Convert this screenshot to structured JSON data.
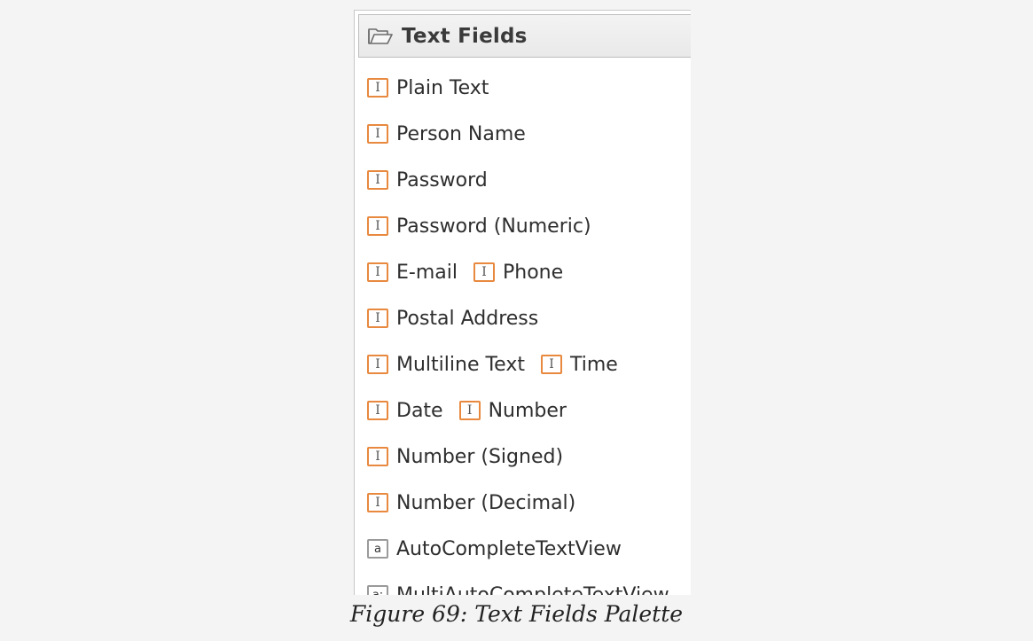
{
  "palette": {
    "header": {
      "title": "Text Fields",
      "icon": "folder-open-icon"
    },
    "rows": [
      [
        {
          "label": "Plain Text",
          "icon": "text-cursor-icon",
          "glyph": "I"
        }
      ],
      [
        {
          "label": "Person Name",
          "icon": "text-cursor-icon",
          "glyph": "I"
        }
      ],
      [
        {
          "label": "Password",
          "icon": "text-cursor-icon",
          "glyph": "I"
        }
      ],
      [
        {
          "label": "Password (Numeric)",
          "icon": "text-cursor-icon",
          "glyph": "I"
        }
      ],
      [
        {
          "label": "E-mail",
          "icon": "text-cursor-icon",
          "glyph": "I"
        },
        {
          "label": "Phone",
          "icon": "text-cursor-icon",
          "glyph": "I"
        }
      ],
      [
        {
          "label": "Postal Address",
          "icon": "text-cursor-icon",
          "glyph": "I"
        }
      ],
      [
        {
          "label": "Multiline Text",
          "icon": "text-cursor-icon",
          "glyph": "I"
        },
        {
          "label": "Time",
          "icon": "text-cursor-icon",
          "glyph": "I"
        }
      ],
      [
        {
          "label": "Date",
          "icon": "text-cursor-icon",
          "glyph": "I"
        },
        {
          "label": "Number",
          "icon": "text-cursor-icon",
          "glyph": "I"
        }
      ],
      [
        {
          "label": "Number (Signed)",
          "icon": "text-cursor-icon",
          "glyph": "I"
        }
      ],
      [
        {
          "label": "Number (Decimal)",
          "icon": "text-cursor-icon",
          "glyph": "I"
        }
      ],
      [
        {
          "label": "AutoCompleteTextView",
          "icon": "autocomplete-icon",
          "glyph": "a"
        }
      ],
      [
        {
          "label": "MultiAutoCompleteTextView",
          "icon": "multi-autocomplete-icon",
          "glyph": "a:"
        }
      ]
    ]
  },
  "caption": "Figure 69: Text Fields Palette",
  "colors": {
    "icon_border": "#e8893f",
    "auto_icon_border": "#9a9a9a",
    "header_bg": "#ececec",
    "page_bg": "#f4f4f4"
  }
}
